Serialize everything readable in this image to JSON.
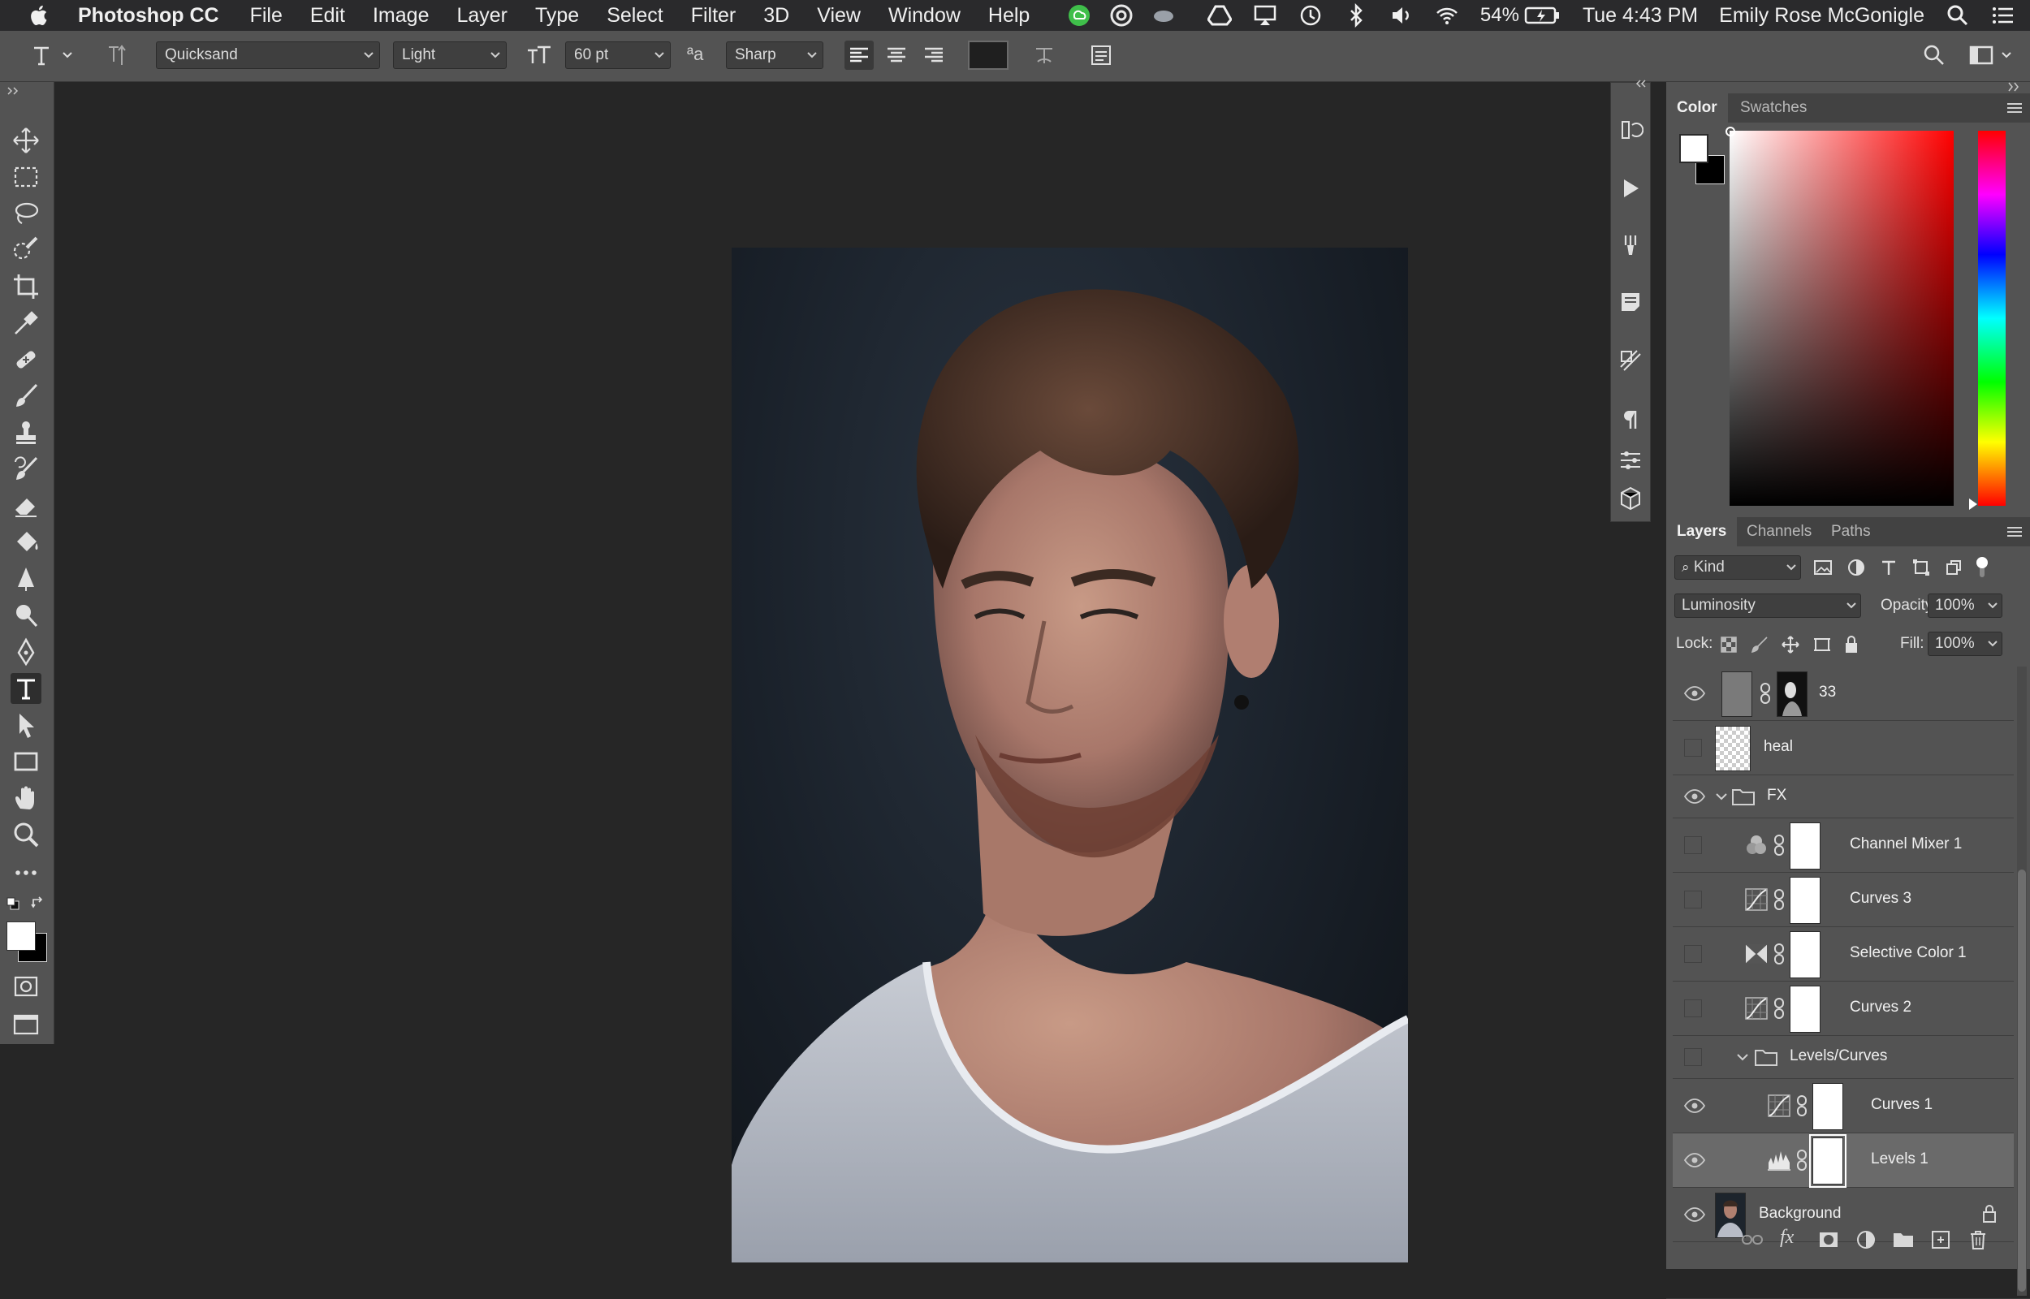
{
  "menubar": {
    "app_name": "Photoshop CC",
    "items": [
      "File",
      "Edit",
      "Image",
      "Layer",
      "Type",
      "Select",
      "Filter",
      "3D",
      "View",
      "Window",
      "Help"
    ],
    "battery": "54%",
    "clock": "Tue 4:43 PM",
    "user": "Emily Rose McGonigle"
  },
  "options": {
    "font_family": "Quicksand",
    "font_style": "Light",
    "font_size": "60 pt",
    "antialias_icon_text": "ªa",
    "antialias": "Sharp"
  },
  "color_panel": {
    "tabs": [
      "Color",
      "Swatches"
    ],
    "foreground": "#ffffff",
    "background": "#000000",
    "hue_color": "#ff0000"
  },
  "layers_panel": {
    "tabs": [
      "Layers",
      "Channels",
      "Paths"
    ],
    "filter_kind": "Kind",
    "blend_mode": "Luminosity",
    "opacity_label": "Opacity:",
    "opacity": "100%",
    "lock_label": "Lock:",
    "fill_label": "Fill:",
    "fill": "100%",
    "layers": [
      {
        "name": "33",
        "visible": true
      },
      {
        "name": "heal",
        "visible": false
      },
      {
        "name": "FX",
        "visible": true
      },
      {
        "name": "Channel Mixer 1",
        "visible": false
      },
      {
        "name": "Curves 3",
        "visible": false
      },
      {
        "name": "Selective Color 1",
        "visible": false
      },
      {
        "name": "Curves 2",
        "visible": false
      },
      {
        "name": "Levels/Curves",
        "visible": false
      },
      {
        "name": "Curves 1",
        "visible": true
      },
      {
        "name": "Levels 1",
        "visible": true
      },
      {
        "name": "Background",
        "visible": true
      }
    ]
  },
  "document": {
    "photo_subject": "portrait"
  }
}
